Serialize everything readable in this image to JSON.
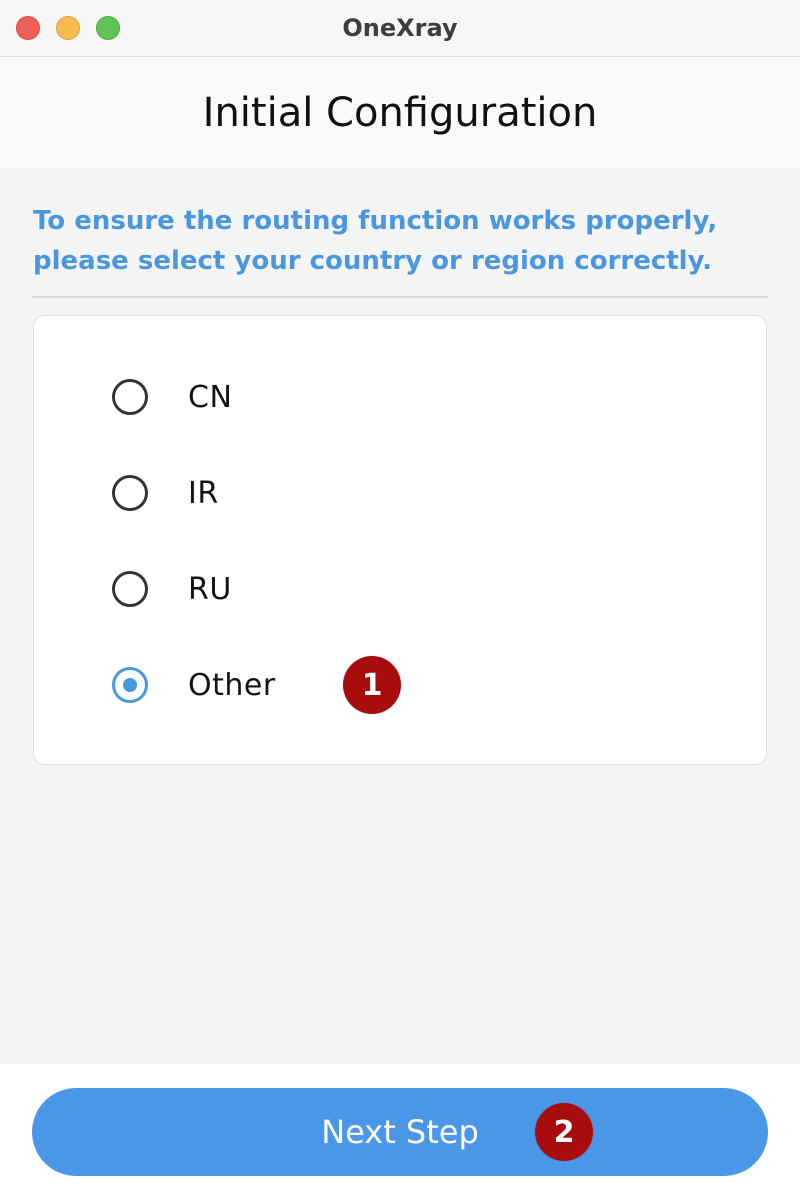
{
  "window": {
    "title": "OneXray"
  },
  "header": {
    "title": "Initial Configuration"
  },
  "content": {
    "instructions": "To ensure the routing function works properly, please select your country or region correctly.",
    "options": [
      {
        "label": "CN",
        "selected": false
      },
      {
        "label": "IR",
        "selected": false
      },
      {
        "label": "RU",
        "selected": false
      },
      {
        "label": "Other",
        "selected": true
      }
    ]
  },
  "badges": {
    "one": "1",
    "two": "2"
  },
  "footer": {
    "next_label": "Next Step"
  },
  "colors": {
    "accent": "#4a97e8",
    "badge": "#a80d0d",
    "close": "#ee5f57",
    "minimize": "#f5bd4f",
    "maximize": "#5fc454"
  }
}
